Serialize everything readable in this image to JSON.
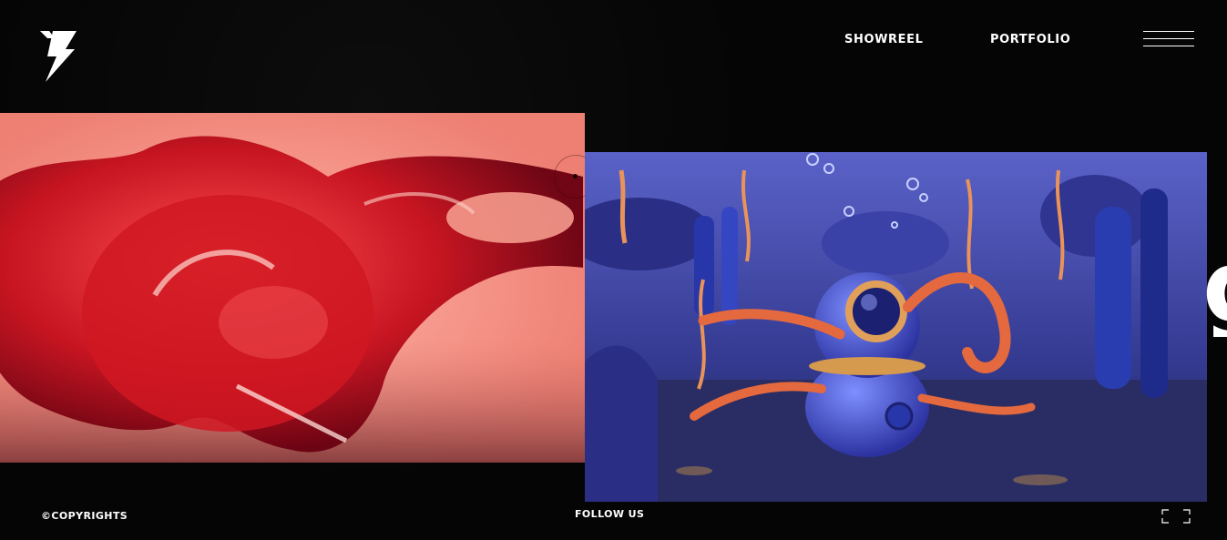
{
  "header": {
    "logo_icon": "lightning-bolt-logo-icon",
    "nav": [
      {
        "label": "SHOWREEL"
      },
      {
        "label": "PORTFOLIO"
      }
    ],
    "menu_icon": "hamburger-menu-icon"
  },
  "slider": {
    "slides": [
      {
        "name": "red-glossy-liquid-render",
        "dominant_color": "#f3897a"
      },
      {
        "name": "underwater-diver-helmet-octopus-render",
        "dominant_color": "#3a3f9a"
      }
    ],
    "edge_text": "g"
  },
  "footer": {
    "copyright": "©COPYRIGHTS",
    "follow": "FOLLOW US",
    "fullscreen_icon": "fullscreen-icon"
  },
  "colors": {
    "background": "#050505",
    "text": "#ffffff"
  }
}
